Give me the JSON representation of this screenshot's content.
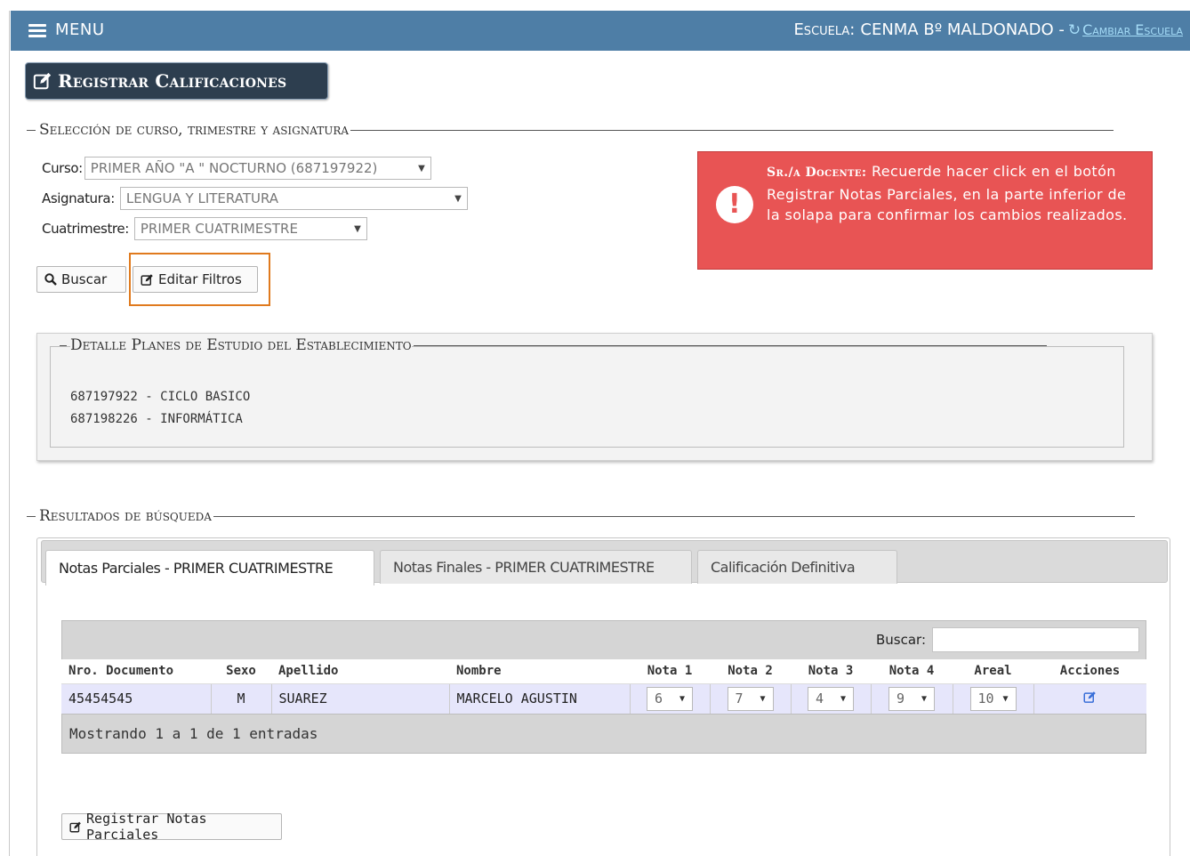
{
  "header": {
    "menu_label": "MENU",
    "school_label": "Escuela:",
    "school_name": "CENMA Bº MALDONADO -",
    "change_school_label": "Cambiar Escuela"
  },
  "page_title": "Registrar Calificaciones",
  "selection": {
    "legend": "Selección de curso, trimestre y asignatura",
    "curso_label": "Curso:",
    "curso_value": "PRIMER AÑO \"A \" NOCTURNO (687197922)",
    "asignatura_label": "Asignatura:",
    "asignatura_value": "LENGUA Y LITERATURA",
    "cuatrimestre_label": "Cuatrimestre:",
    "cuatrimestre_value": "PRIMER CUATRIMESTRE",
    "buscar_label": "Buscar",
    "editar_filtros_label": "Editar Filtros"
  },
  "alert": {
    "title": "Sr./a Docente:",
    "message": "Recuerde hacer click en el botón Registrar Notas Parciales, en la parte inferior de la solapa para confirmar los cambios realizados.",
    "icon": "exclamation-icon",
    "color": "#e85454"
  },
  "plans": {
    "legend": "Detalle Planes de Estudio del Establecimiento",
    "items": [
      "687197922 - CICLO BASICO",
      "687198226 - INFORMÁTICA"
    ]
  },
  "results": {
    "legend": "Resultados de búsqueda",
    "tabs": [
      {
        "label": "Notas Parciales - PRIMER CUATRIMESTRE",
        "active": true
      },
      {
        "label": "Notas Finales - PRIMER CUATRIMESTRE",
        "active": false
      },
      {
        "label": "Calificación Definitiva",
        "active": false
      }
    ],
    "search_label": "Buscar:",
    "columns": [
      "Nro. Documento",
      "Sexo",
      "Apellido",
      "Nombre",
      "Nota 1",
      "Nota 2",
      "Nota 3",
      "Nota 4",
      "Areal",
      "Acciones"
    ],
    "rows": [
      {
        "documento": "45454545",
        "sexo": "M",
        "apellido": "SUAREZ",
        "nombre": "MARCELO AGUSTIN",
        "nota1": "6",
        "nota2": "7",
        "nota3": "4",
        "nota4": "9",
        "areal": "10"
      }
    ],
    "footer_text": "Mostrando 1 a 1 de 1 entradas",
    "register_button_label": "Registrar Notas Parciales"
  },
  "colors": {
    "topbar": "#4e7ea6",
    "title_button": "#2d3e4f",
    "highlight": "#e07a1e",
    "row_bg": "#e6e6fb"
  }
}
